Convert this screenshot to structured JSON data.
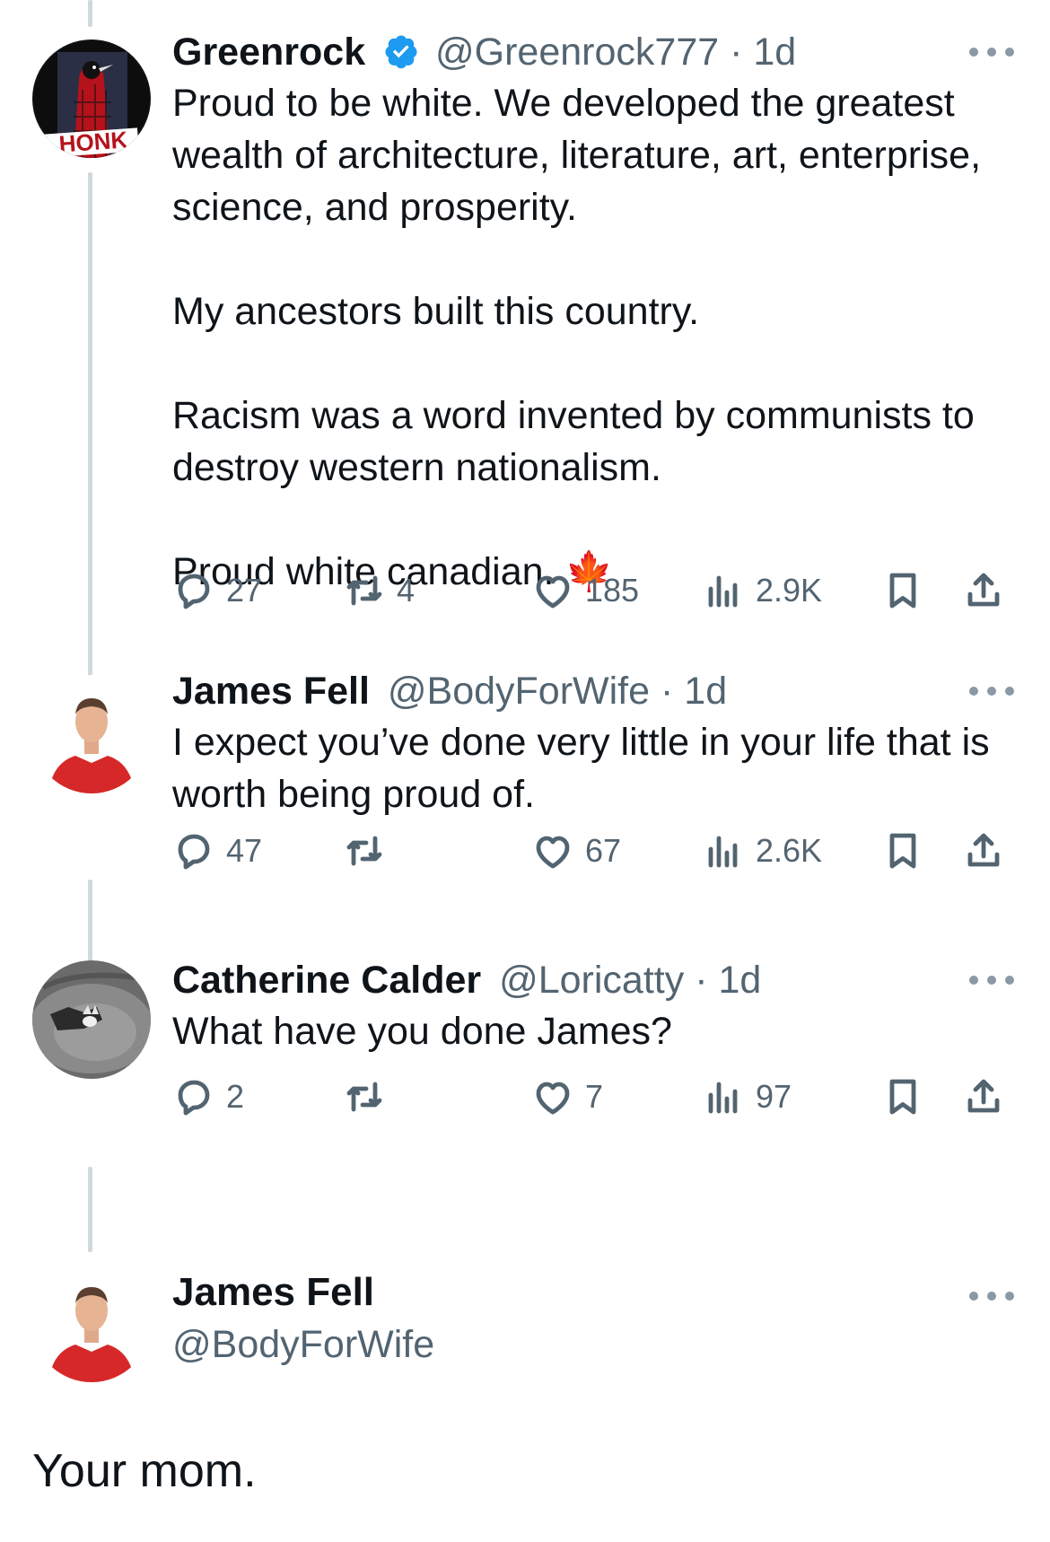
{
  "tweets": [
    {
      "name": "Greenrock",
      "verified": true,
      "handle": "@Greenrock777",
      "dot": "·",
      "time": "1d",
      "text": "Proud to be white. We developed the greatest wealth of architecture, literature, art, enterprise, science, and prosperity.\n\nMy ancestors built this country.\n\nRacism was a word invented by communists to destroy western nationalism.\n\nProud white canadian.",
      "emoji": "🍁",
      "avatar_label": "HONK",
      "replies": "27",
      "retweets": "4",
      "likes": "185",
      "views": "2.9K"
    },
    {
      "name": "James Fell",
      "handle": "@BodyForWife",
      "dot": "·",
      "time": "1d",
      "text": "I expect you’ve done very little in your life that is worth being proud of.",
      "replies": "47",
      "retweets": "",
      "likes": "67",
      "views": "2.6K"
    },
    {
      "name": "Catherine Calder",
      "handle": "@Loricatty",
      "dot": "·",
      "time": "1d",
      "text": "What have you done James?",
      "replies": "2",
      "retweets": "",
      "likes": "7",
      "views": "97"
    }
  ],
  "focused": {
    "name": "James Fell",
    "handle": "@BodyForWife",
    "text": "Your mom."
  },
  "colors": {
    "text": "#0f1419",
    "muted": "#536471",
    "verified": "#1d9bf0",
    "thread_line": "#cfd9de",
    "shirt": "#d62828"
  },
  "icons": [
    "reply-icon",
    "retweet-icon",
    "like-icon",
    "views-icon",
    "bookmark-icon",
    "share-icon",
    "more-icon",
    "verified-icon"
  ]
}
